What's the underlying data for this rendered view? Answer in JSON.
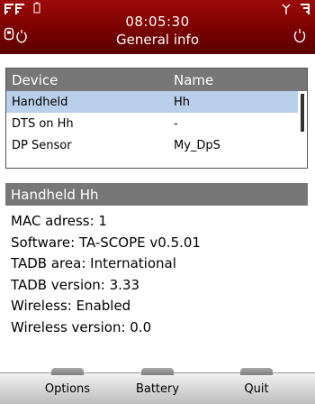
{
  "header": {
    "time": "08:05:30",
    "title": "General info"
  },
  "table": {
    "columns": [
      "Device",
      "Name"
    ],
    "rows": [
      {
        "device": "Handheld",
        "name": "Hh"
      },
      {
        "device": "DTS on Hh",
        "name": "-"
      },
      {
        "device": "DP Sensor",
        "name": "My_DpS"
      }
    ]
  },
  "info": {
    "heading": "Handheld Hh",
    "lines": [
      "MAC adress: 1",
      "Software: TA-SCOPE v0.5.01",
      "TADB area: International",
      "TADB version: 3.33",
      "Wireless: Enabled",
      "Wireless version: 0.0"
    ]
  },
  "softkeys": {
    "left": "Options",
    "center": "Battery",
    "right": "Quit"
  },
  "colors": {
    "header_bg": "#8a0000",
    "panel_header": "#777777",
    "selection": "#b9cfea"
  }
}
